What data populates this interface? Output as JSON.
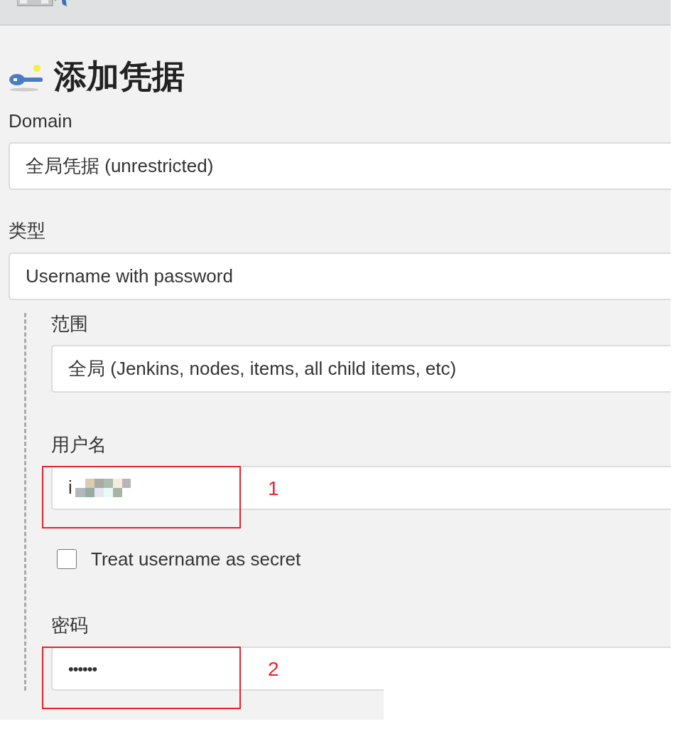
{
  "header": {
    "kind": "toolbar"
  },
  "title": "添加凭据",
  "fields": [
    {
      "kind": "select",
      "label": "Domain",
      "value": "全局凭据 (unrestricted)"
    },
    {
      "kind": "select",
      "label": "类型",
      "value": "Username with password"
    }
  ],
  "nested_fields": [
    {
      "kind": "select",
      "label": "范围",
      "value": "全局 (Jenkins, nodes, items, all child items, etc)"
    },
    {
      "kind": "text",
      "label": "用户名",
      "value": "i",
      "redacted": true,
      "annotation": "1"
    },
    {
      "kind": "checkbox",
      "label": "Treat username as secret",
      "checked": false
    },
    {
      "kind": "password",
      "label": "密码",
      "value": "••••••",
      "annotation": "2"
    }
  ]
}
